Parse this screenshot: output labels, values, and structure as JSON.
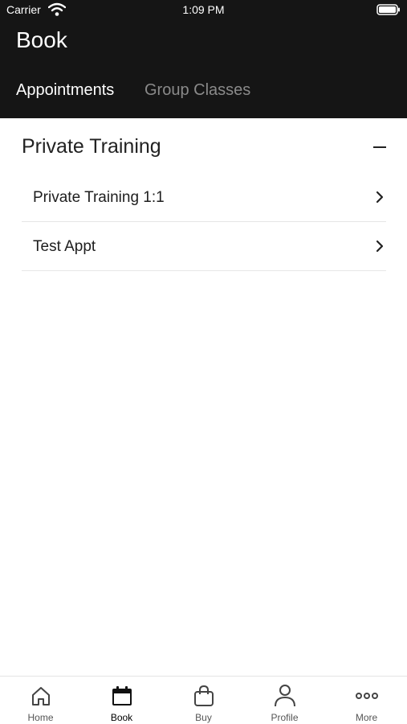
{
  "status_bar": {
    "carrier": "Carrier",
    "time": "1:09 PM"
  },
  "header": {
    "title": "Book",
    "tabs": [
      {
        "label": "Appointments",
        "active": true
      },
      {
        "label": "Group Classes",
        "active": false
      }
    ]
  },
  "section": {
    "title": "Private Training",
    "items": [
      {
        "label": "Private Training 1:1"
      },
      {
        "label": "Test Appt"
      }
    ]
  },
  "tabbar": {
    "items": [
      {
        "label": "Home",
        "icon": "home-icon"
      },
      {
        "label": "Book",
        "icon": "calendar-icon",
        "active": true
      },
      {
        "label": "Buy",
        "icon": "shopping-bag-icon"
      },
      {
        "label": "Profile",
        "icon": "person-icon"
      },
      {
        "label": "More",
        "icon": "more-dots-icon"
      }
    ]
  },
  "colors": {
    "header_bg": "#151515",
    "active_tab": "#ffffff",
    "inactive_tab": "#8a8a8a"
  }
}
